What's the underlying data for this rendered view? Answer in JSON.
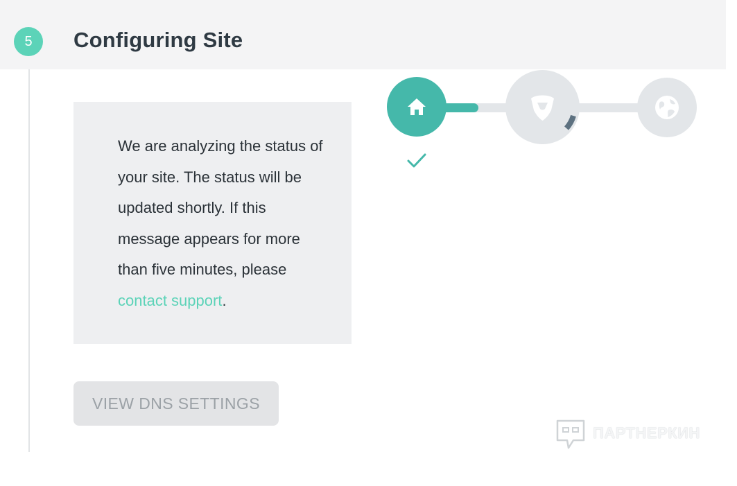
{
  "step": {
    "number": "5",
    "title": "Configuring Site"
  },
  "message": {
    "text": "We are analyzing the status of your site. The status will be updated shortly. If this message appears for more than five minutes, please ",
    "link_label": "contact support",
    "suffix": "."
  },
  "dns_button_label": "VIEW DNS SETTINGS",
  "progress": {
    "stages": [
      {
        "icon": "home-icon",
        "state": "complete"
      },
      {
        "icon": "shield-icon",
        "state": "in-progress"
      },
      {
        "icon": "globe-icon",
        "state": "pending"
      }
    ]
  },
  "watermark": {
    "text": "ПАРТНЕРКИН"
  },
  "colors": {
    "accent": "#5cd3b8",
    "active_stage": "#45b8aa",
    "pending_stage": "#e3e6e9",
    "header_bg": "#f4f4f5",
    "box_bg": "#eeeff1"
  }
}
